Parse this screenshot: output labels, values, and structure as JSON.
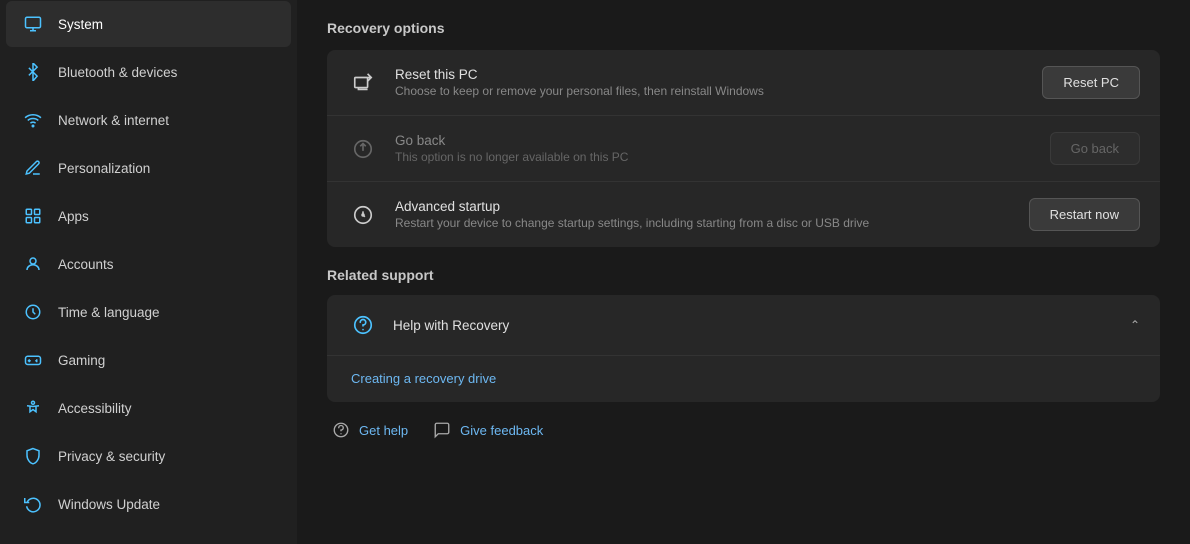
{
  "sidebar": {
    "items": [
      {
        "id": "system",
        "label": "System",
        "active": true,
        "icon": "monitor"
      },
      {
        "id": "bluetooth",
        "label": "Bluetooth & devices",
        "active": false,
        "icon": "bluetooth"
      },
      {
        "id": "network",
        "label": "Network & internet",
        "active": false,
        "icon": "network"
      },
      {
        "id": "personalization",
        "label": "Personalization",
        "active": false,
        "icon": "personalization"
      },
      {
        "id": "apps",
        "label": "Apps",
        "active": false,
        "icon": "apps"
      },
      {
        "id": "accounts",
        "label": "Accounts",
        "active": false,
        "icon": "accounts"
      },
      {
        "id": "time",
        "label": "Time & language",
        "active": false,
        "icon": "time"
      },
      {
        "id": "gaming",
        "label": "Gaming",
        "active": false,
        "icon": "gaming"
      },
      {
        "id": "accessibility",
        "label": "Accessibility",
        "active": false,
        "icon": "accessibility"
      },
      {
        "id": "privacy",
        "label": "Privacy & security",
        "active": false,
        "icon": "privacy"
      },
      {
        "id": "windowsupdate",
        "label": "Windows Update",
        "active": false,
        "icon": "windowsupdate"
      }
    ]
  },
  "main": {
    "recovery_options_title": "Recovery options",
    "reset_label": "Reset this PC",
    "reset_sublabel": "Choose to keep or remove your personal files, then reinstall Windows",
    "reset_btn": "Reset PC",
    "goback_label": "Go back",
    "goback_sublabel": "This option is no longer available on this PC",
    "goback_btn": "Go back",
    "advanced_label": "Advanced startup",
    "advanced_sublabel": "Restart your device to change startup settings, including starting from a disc or USB drive",
    "advanced_btn": "Restart now",
    "related_support_title": "Related support",
    "help_recovery_label": "Help with Recovery",
    "creating_drive_label": "Creating a recovery drive",
    "get_help_label": "Get help",
    "give_feedback_label": "Give feedback"
  }
}
